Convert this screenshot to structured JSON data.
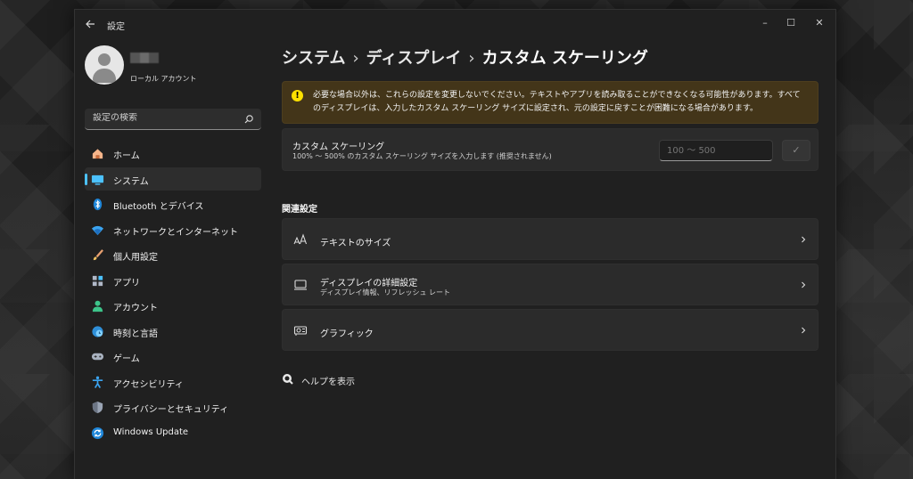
{
  "window": {
    "app_title": "設定",
    "controls": {
      "minimize": "–",
      "maximize": "☐",
      "close": "✕"
    }
  },
  "account": {
    "type": "ローカル アカウント"
  },
  "search": {
    "placeholder": "設定の検索"
  },
  "nav": {
    "items": [
      {
        "label": "ホーム",
        "icon": "home-icon",
        "active": false
      },
      {
        "label": "システム",
        "icon": "system-icon",
        "active": true
      },
      {
        "label": "Bluetooth とデバイス",
        "icon": "bluetooth-icon",
        "active": false
      },
      {
        "label": "ネットワークとインターネット",
        "icon": "wifi-icon",
        "active": false
      },
      {
        "label": "個人用設定",
        "icon": "brush-icon",
        "active": false
      },
      {
        "label": "アプリ",
        "icon": "apps-icon",
        "active": false
      },
      {
        "label": "アカウント",
        "icon": "person-icon",
        "active": false
      },
      {
        "label": "時刻と言語",
        "icon": "globe-clock-icon",
        "active": false
      },
      {
        "label": "ゲーム",
        "icon": "gamepad-icon",
        "active": false
      },
      {
        "label": "アクセシビリティ",
        "icon": "accessibility-icon",
        "active": false
      },
      {
        "label": "プライバシーとセキュリティ",
        "icon": "shield-icon",
        "active": false
      },
      {
        "label": "Windows Update",
        "icon": "sync-icon",
        "active": false
      }
    ]
  },
  "breadcrumb": {
    "items": [
      "システム",
      "ディスプレイ",
      "カスタム スケーリング"
    ],
    "separator": "›"
  },
  "warning": {
    "icon": "!",
    "text": "必要な場合以外は、これらの設定を変更しないでください。テキストやアプリを読み取ることができなくなる可能性があります。すべてのディスプレイは、入力したカスタム スケーリング サイズに設定され、元の設定に戻すことが困難になる場合があります。"
  },
  "custom_scaling": {
    "title": "カスタム スケーリング",
    "description": "100% 〜 500% のカスタム スケーリング サイズを入力します (推奨されません)",
    "input_placeholder": "100 〜 500",
    "apply_label": "✓"
  },
  "related": {
    "section_title": "関連設定",
    "rows": [
      {
        "title": "テキストのサイズ",
        "subtitle": "",
        "icon": "text-size-icon"
      },
      {
        "title": "ディスプレイの詳細設定",
        "subtitle": "ディスプレイ情報、リフレッシュ レート",
        "icon": "monitor-icon"
      },
      {
        "title": "グラフィック",
        "subtitle": "",
        "icon": "graphics-card-icon"
      }
    ]
  },
  "help": {
    "label": "ヘルプを表示"
  },
  "colors": {
    "accent": "#4cc2ff",
    "warning_bg": "#433519",
    "warning_icon": "#fce100",
    "window_bg": "#202020",
    "card_bg": "#2b2b2b"
  }
}
